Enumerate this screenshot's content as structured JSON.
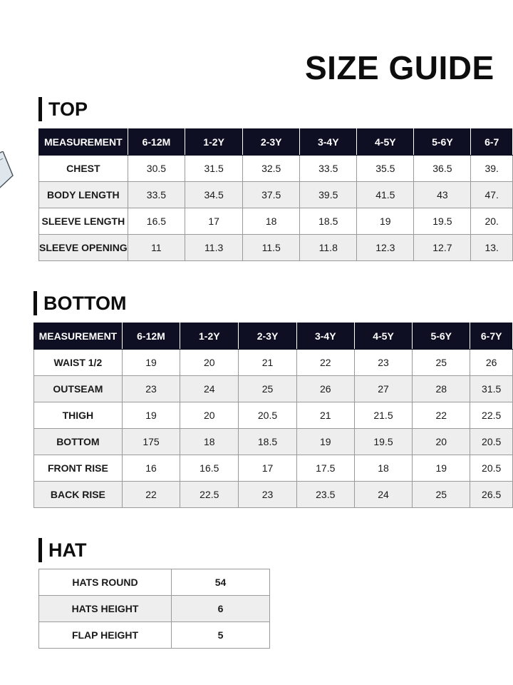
{
  "page_title": "SIZE GUIDE",
  "top": {
    "heading": "TOP",
    "columns": [
      "MEASUREMENT",
      "6-12M",
      "1-2Y",
      "2-3Y",
      "3-4Y",
      "4-5Y",
      "5-6Y",
      "6-7"
    ],
    "rows": [
      {
        "label": "CHEST",
        "values": [
          "30.5",
          "31.5",
          "32.5",
          "33.5",
          "35.5",
          "36.5",
          "39."
        ]
      },
      {
        "label": "BODY LENGTH",
        "values": [
          "33.5",
          "34.5",
          "37.5",
          "39.5",
          "41.5",
          "43",
          "47."
        ]
      },
      {
        "label": "SLEEVE LENGTH",
        "values": [
          "16.5",
          "17",
          "18",
          "18.5",
          "19",
          "19.5",
          "20."
        ]
      },
      {
        "label": "SLEEVE OPENING",
        "values": [
          "11",
          "11.3",
          "11.5",
          "11.8",
          "12.3",
          "12.7",
          "13."
        ]
      }
    ]
  },
  "bottom": {
    "heading": "BOTTOM",
    "columns": [
      "MEASUREMENT",
      "6-12M",
      "1-2Y",
      "2-3Y",
      "3-4Y",
      "4-5Y",
      "5-6Y",
      "6-7Y"
    ],
    "rows": [
      {
        "label": "WAIST 1/2",
        "values": [
          "19",
          "20",
          "21",
          "22",
          "23",
          "25",
          "26"
        ]
      },
      {
        "label": "OUTSEAM",
        "values": [
          "23",
          "24",
          "25",
          "26",
          "27",
          "28",
          "31.5"
        ]
      },
      {
        "label": "THIGH",
        "values": [
          "19",
          "20",
          "20.5",
          "21",
          "21.5",
          "22",
          "22.5"
        ]
      },
      {
        "label": "BOTTOM",
        "values": [
          "175",
          "18",
          "18.5",
          "19",
          "19.5",
          "20",
          "20.5"
        ]
      },
      {
        "label": "FRONT RISE",
        "values": [
          "16",
          "16.5",
          "17",
          "17.5",
          "18",
          "19",
          "20.5"
        ]
      },
      {
        "label": "BACK RISE",
        "values": [
          "22",
          "22.5",
          "23",
          "23.5",
          "24",
          "25",
          "26.5"
        ]
      }
    ]
  },
  "hat": {
    "heading": "HAT",
    "rows": [
      {
        "label": "HATS ROUND",
        "value": "54"
      },
      {
        "label": "HATS HEIGHT",
        "value": "6"
      },
      {
        "label": "FLAP HEIGHT",
        "value": "5"
      }
    ]
  },
  "colors": {
    "header_bg": "#0e0f23",
    "alt_row_bg": "#eeeeee",
    "text": "#1a1a1a"
  },
  "icons": {
    "garment_edge": "garment-illustration-fragment"
  }
}
